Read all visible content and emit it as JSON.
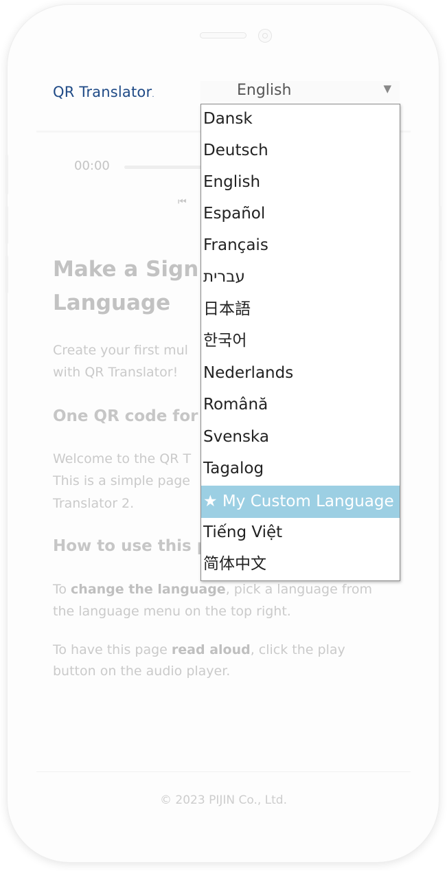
{
  "app": {
    "logo_text": "QR Translator",
    "logo_dot": "."
  },
  "language_select": {
    "current": "English",
    "caret": "▼",
    "options": [
      "Dansk",
      "Deutsch",
      "English",
      "Español",
      "Français",
      "עברית",
      "日本語",
      "한국어",
      "Nederlands",
      "Română",
      "Svenska",
      "Tagalog",
      "★ My Custom Language",
      "Tiếng Việt",
      "简体中文"
    ],
    "highlighted": "★ My Custom Language"
  },
  "audio_player": {
    "time": "00:00",
    "prev_icon": "⏮"
  },
  "content": {
    "title_line1": "Make a Sign S",
    "title_line2": "Language",
    "intro_line1": "Create your first mul",
    "intro_line2": "with QR Translator!",
    "section1_heading": "One QR code for",
    "section1_line1": "Welcome to the QR T",
    "section1_line2": "This is a simple page",
    "section1_line3": "Translator 2.",
    "section2_heading": "How to use this p",
    "how_p1_pre": "To ",
    "how_p1_bold": "change the language",
    "how_p1_post": ", pick a language from",
    "how_p1_line2": "the language menu on the top right.",
    "how_p2_pre": "To have this page ",
    "how_p2_bold": "read aloud",
    "how_p2_post": ", click the play",
    "how_p2_line2": "button on the audio player."
  },
  "footer": {
    "copyright": "© 2023 PIJIN Co., Ltd."
  },
  "colors": {
    "brand": "#1f4a86",
    "selected_option": "#9ccfe3"
  }
}
